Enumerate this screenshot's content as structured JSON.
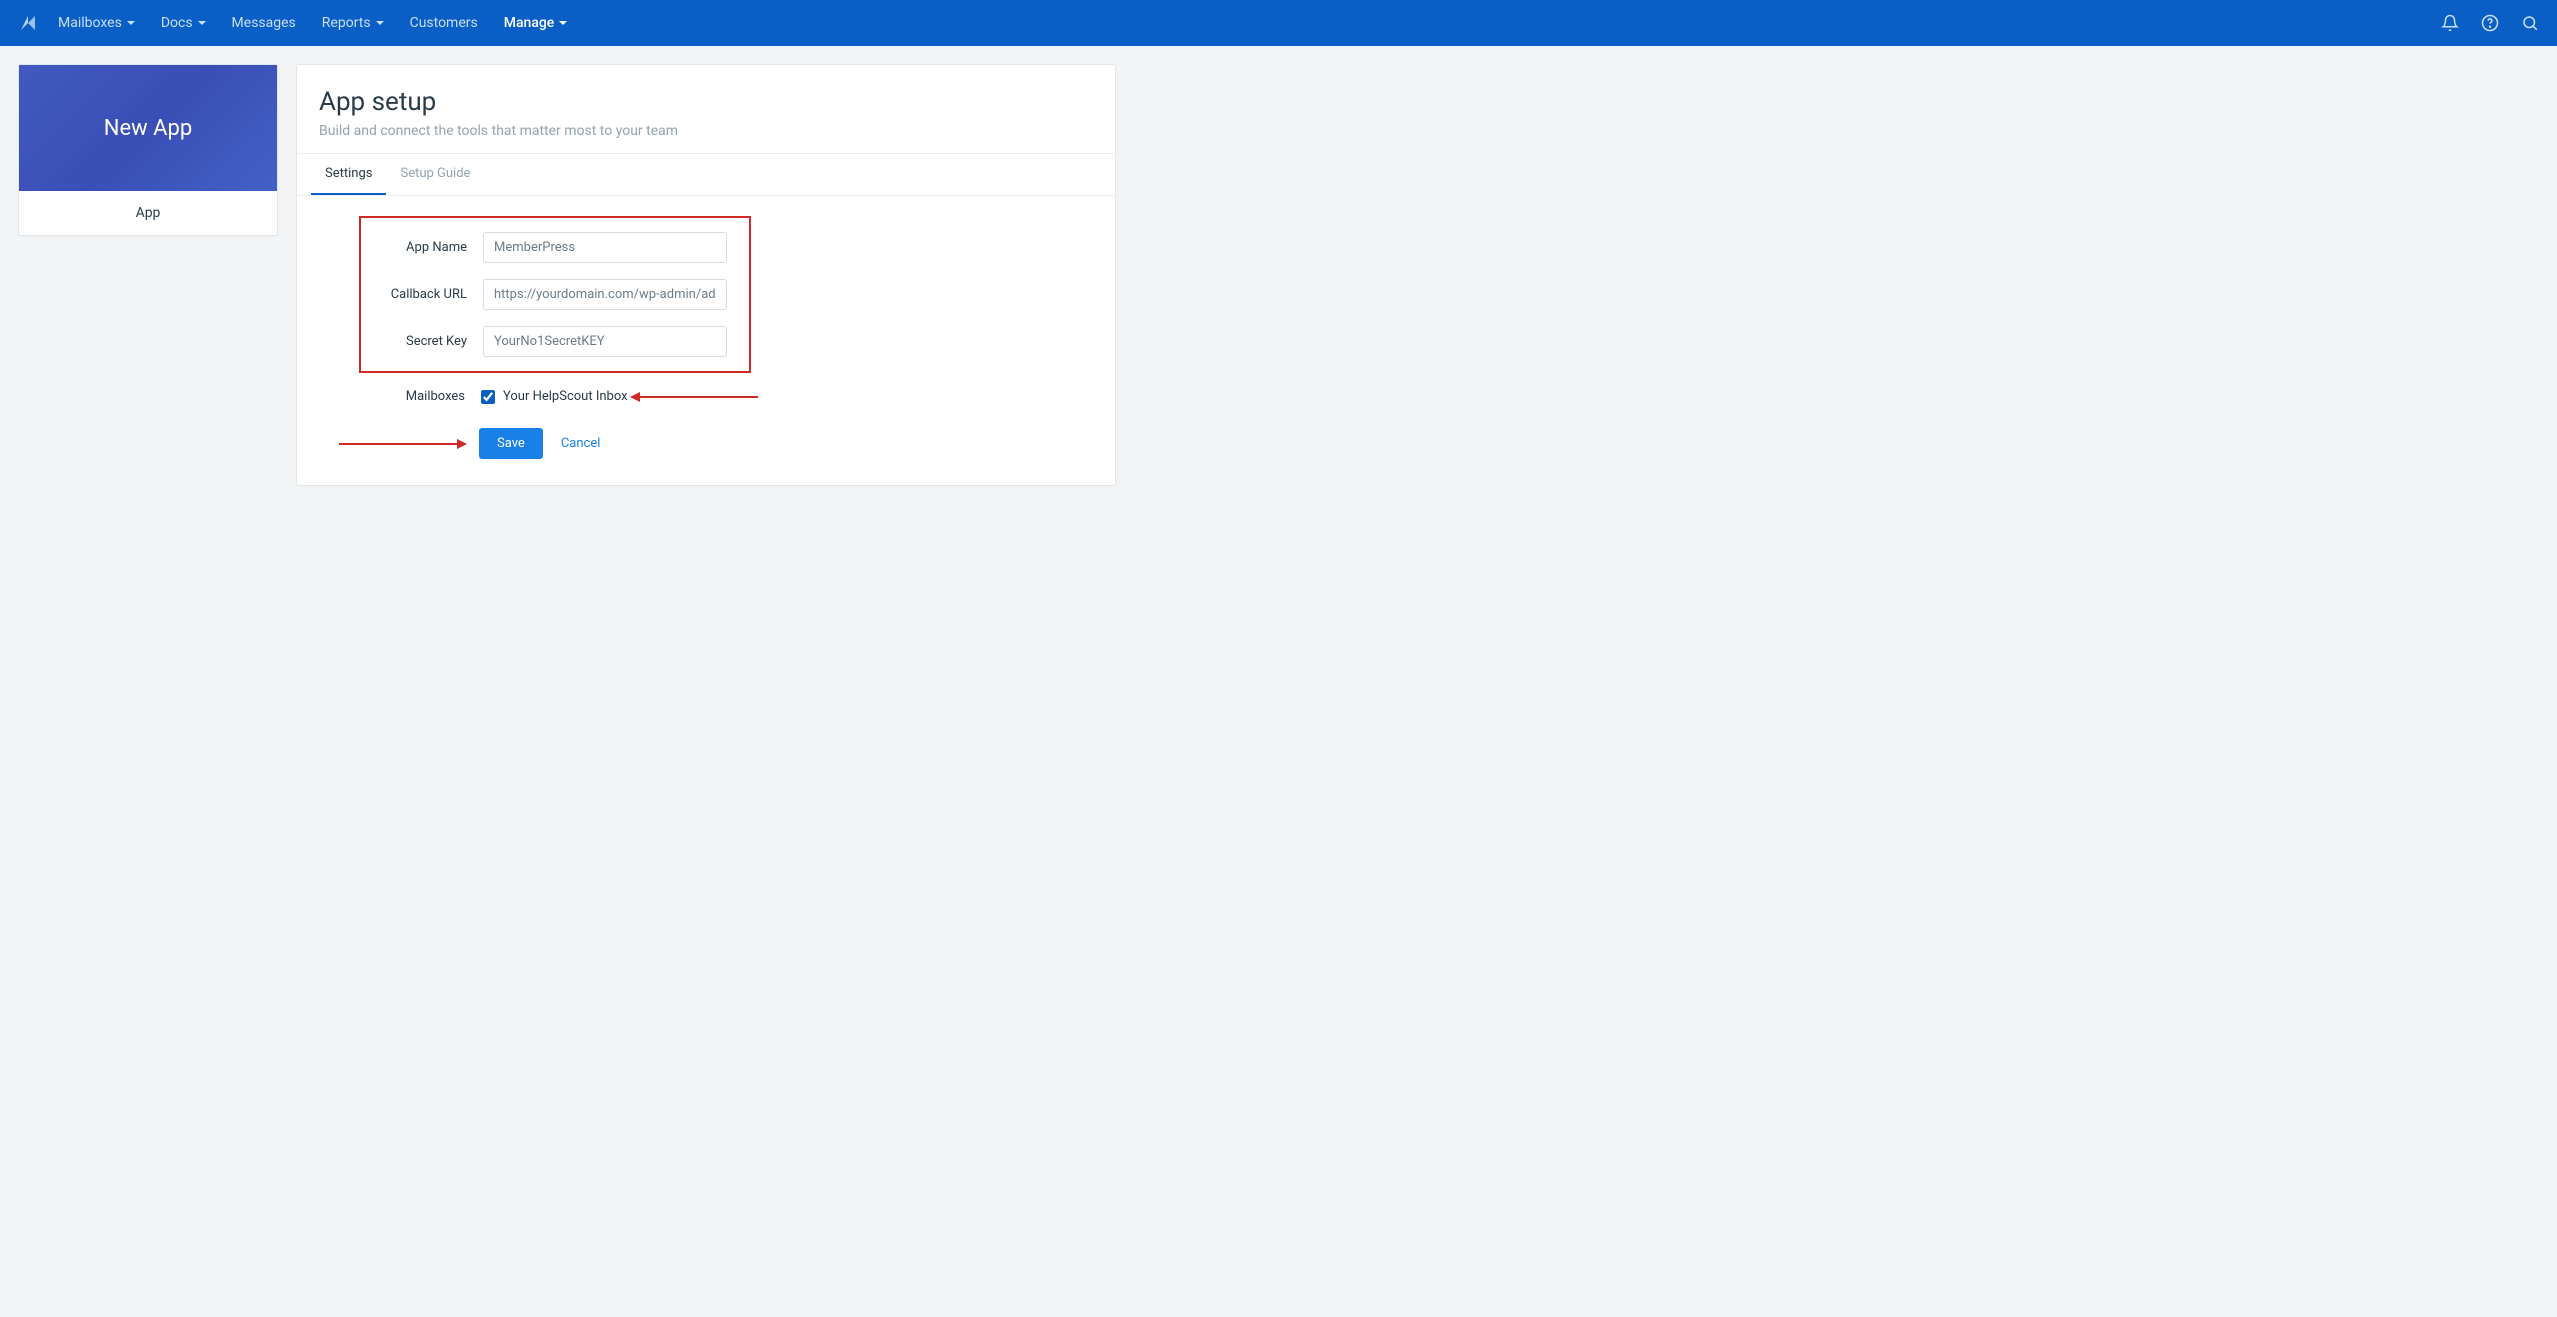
{
  "topnav": {
    "items": [
      {
        "label": "Mailboxes",
        "chev": true
      },
      {
        "label": "Docs",
        "chev": true
      },
      {
        "label": "Messages",
        "chev": false
      },
      {
        "label": "Reports",
        "chev": true
      },
      {
        "label": "Customers",
        "chev": false
      },
      {
        "label": "Manage",
        "chev": true,
        "active": true
      }
    ]
  },
  "sidebar": {
    "hero": "New App",
    "tab": "App"
  },
  "panel": {
    "title": "App setup",
    "subtitle": "Build and connect the tools that matter most to your team",
    "tabs": [
      {
        "label": "Settings",
        "active": true
      },
      {
        "label": "Setup Guide",
        "active": false
      }
    ]
  },
  "form": {
    "app_name": {
      "label": "App Name",
      "value": "MemberPress"
    },
    "callback_url": {
      "label": "Callback URL",
      "value": "https://yourdomain.com/wp-admin/admin-a"
    },
    "secret_key": {
      "label": "Secret Key",
      "value": "YourNo1SecretKEY"
    },
    "mailboxes_label": "Mailboxes",
    "mailbox_option": "Your HelpScout Inbox",
    "save_label": "Save",
    "cancel_label": "Cancel"
  }
}
